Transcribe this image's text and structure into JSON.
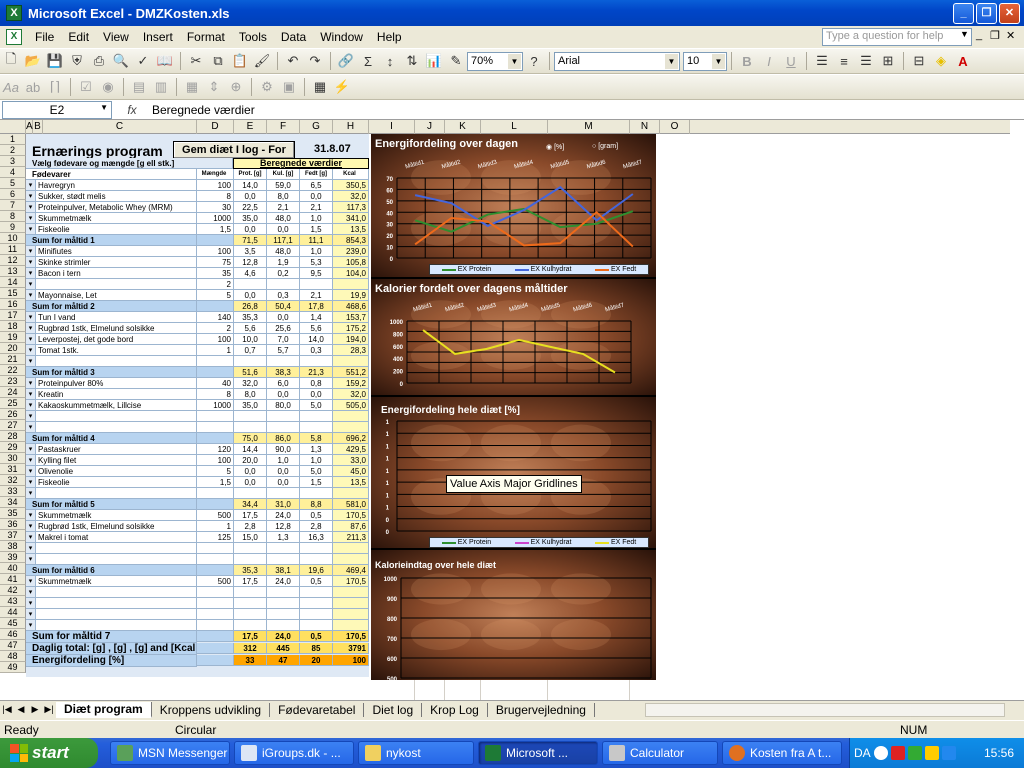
{
  "app": {
    "title": "Microsoft Excel - DMZKosten.xls"
  },
  "menu": [
    "File",
    "Edit",
    "View",
    "Insert",
    "Format",
    "Tools",
    "Data",
    "Window",
    "Help"
  ],
  "help_placeholder": "Type a question for help",
  "toolbar": {
    "zoom": "70%",
    "font": "Arial",
    "size": "10",
    "bold": "B",
    "italic": "I",
    "underline": "U"
  },
  "formula": {
    "cell": "E2",
    "fx": "fx",
    "value": "Beregnede værdier"
  },
  "columns": [
    "A",
    "B",
    "C",
    "D",
    "E",
    "F",
    "G",
    "H",
    "I",
    "J",
    "K",
    "L",
    "M",
    "N",
    "O"
  ],
  "rows": [
    "1",
    "2",
    "3",
    "4",
    "5",
    "6",
    "7",
    "8",
    "9",
    "10",
    "11",
    "12",
    "13",
    "14",
    "15",
    "16",
    "17",
    "18",
    "19",
    "20",
    "21",
    "22",
    "23",
    "24",
    "25",
    "26",
    "27",
    "28",
    "29",
    "30",
    "31",
    "32",
    "33",
    "34",
    "35",
    "36",
    "37",
    "38",
    "39",
    "40",
    "41",
    "42",
    "43",
    "44",
    "45",
    "46",
    "47",
    "48",
    "49"
  ],
  "program": {
    "title": "Ernærings program",
    "save_button": "Gem diæt I log - For",
    "date": "31.8.07",
    "choose": "Vælg fødevare og mængde [g ell stk.]",
    "calculated": "Beregnede værdier",
    "headers": [
      "Fødevarer",
      "Mængde",
      "Prot. [g]",
      "Kul. [g]",
      "Fedt [g]",
      "Kcal"
    ]
  },
  "table": [
    {
      "type": "item",
      "name": "Havregryn",
      "amt": "100",
      "p": "14,0",
      "k": "59,0",
      "f": "6,5",
      "kcal": "350,5"
    },
    {
      "type": "item",
      "name": "Sukker, stødt melis",
      "amt": "8",
      "p": "0,0",
      "k": "8,0",
      "f": "0,0",
      "kcal": "32,0"
    },
    {
      "type": "item",
      "name": "Proteinpulver, Metabolic Whey (MRM)",
      "amt": "30",
      "p": "22,5",
      "k": "2,1",
      "f": "2,1",
      "kcal": "117,3"
    },
    {
      "type": "item",
      "name": "Skummetmælk",
      "amt": "1000",
      "p": "35,0",
      "k": "48,0",
      "f": "1,0",
      "kcal": "341,0"
    },
    {
      "type": "item",
      "name": "Fiskeolie",
      "amt": "1,5",
      "p": "0,0",
      "k": "0,0",
      "f": "1,5",
      "kcal": "13,5"
    },
    {
      "type": "sum",
      "name": "Sum for måltid 1",
      "amt": "",
      "p": "71,5",
      "k": "117,1",
      "f": "11,1",
      "kcal": "854,3"
    },
    {
      "type": "item",
      "name": "Minifiutes",
      "amt": "100",
      "p": "3,5",
      "k": "48,0",
      "f": "1,0",
      "kcal": "239,0"
    },
    {
      "type": "item",
      "name": "Skinke strimler",
      "amt": "75",
      "p": "12,8",
      "k": "1,9",
      "f": "5,3",
      "kcal": "105,8"
    },
    {
      "type": "item",
      "name": "Bacon i tern",
      "amt": "35",
      "p": "4,6",
      "k": "0,2",
      "f": "9,5",
      "kcal": "104,0"
    },
    {
      "type": "item",
      "name": "",
      "amt": "2",
      "p": "",
      "k": "",
      "f": "",
      "kcal": ""
    },
    {
      "type": "item",
      "name": "Mayonnaise, Let",
      "amt": "5",
      "p": "0,0",
      "k": "0,3",
      "f": "2,1",
      "kcal": "19,9"
    },
    {
      "type": "sum",
      "name": "Sum for måltid 2",
      "amt": "",
      "p": "26,8",
      "k": "50,4",
      "f": "17,8",
      "kcal": "468,6"
    },
    {
      "type": "item",
      "name": "Tun I vand",
      "amt": "140",
      "p": "35,3",
      "k": "0,0",
      "f": "1,4",
      "kcal": "153,7"
    },
    {
      "type": "item",
      "name": "Rugbrød 1stk, Elmelund solsikke",
      "amt": "2",
      "p": "5,6",
      "k": "25,6",
      "f": "5,6",
      "kcal": "175,2"
    },
    {
      "type": "item",
      "name": "Leverpostej, det gode bord",
      "amt": "100",
      "p": "10,0",
      "k": "7,0",
      "f": "14,0",
      "kcal": "194,0"
    },
    {
      "type": "item",
      "name": "Tomat 1stk.",
      "amt": "1",
      "p": "0,7",
      "k": "5,7",
      "f": "0,3",
      "kcal": "28,3"
    },
    {
      "type": "item",
      "name": "",
      "amt": "",
      "p": "",
      "k": "",
      "f": "",
      "kcal": ""
    },
    {
      "type": "sum",
      "name": "Sum for måltid 3",
      "amt": "",
      "p": "51,6",
      "k": "38,3",
      "f": "21,3",
      "kcal": "551,2"
    },
    {
      "type": "item",
      "name": "Proteinpulver 80%",
      "amt": "40",
      "p": "32,0",
      "k": "6,0",
      "f": "0,8",
      "kcal": "159,2"
    },
    {
      "type": "item",
      "name": "Kreatin",
      "amt": "8",
      "p": "8,0",
      "k": "0,0",
      "f": "0,0",
      "kcal": "32,0"
    },
    {
      "type": "item",
      "name": "Kakaoskummetmælk, Lillcise",
      "amt": "1000",
      "p": "35,0",
      "k": "80,0",
      "f": "5,0",
      "kcal": "505,0"
    },
    {
      "type": "item",
      "name": "",
      "amt": "",
      "p": "",
      "k": "",
      "f": "",
      "kcal": ""
    },
    {
      "type": "item",
      "name": "",
      "amt": "",
      "p": "",
      "k": "",
      "f": "",
      "kcal": ""
    },
    {
      "type": "sum",
      "name": "Sum for måltid 4",
      "amt": "",
      "p": "75,0",
      "k": "86,0",
      "f": "5,8",
      "kcal": "696,2"
    },
    {
      "type": "item",
      "name": "Pastaskruer",
      "amt": "120",
      "p": "14,4",
      "k": "90,0",
      "f": "1,3",
      "kcal": "429,5"
    },
    {
      "type": "item",
      "name": "Kylling filet",
      "amt": "100",
      "p": "20,0",
      "k": "1,0",
      "f": "1,0",
      "kcal": "33,0"
    },
    {
      "type": "item",
      "name": "Olivenolie",
      "amt": "5",
      "p": "0,0",
      "k": "0,0",
      "f": "5,0",
      "kcal": "45,0"
    },
    {
      "type": "item",
      "name": "Fiskeolie",
      "amt": "1,5",
      "p": "0,0",
      "k": "0,0",
      "f": "1,5",
      "kcal": "13,5"
    },
    {
      "type": "item",
      "name": "",
      "amt": "",
      "p": "",
      "k": "",
      "f": "",
      "kcal": ""
    },
    {
      "type": "sum",
      "name": "Sum for måltid 5",
      "amt": "",
      "p": "34,4",
      "k": "31,0",
      "f": "8,8",
      "kcal": "581,0"
    },
    {
      "type": "item",
      "name": "Skummetmælk",
      "amt": "500",
      "p": "17,5",
      "k": "24,0",
      "f": "0,5",
      "kcal": "170,5"
    },
    {
      "type": "item",
      "name": "Rugbrød 1stk, Elmelund solsikke",
      "amt": "1",
      "p": "2,8",
      "k": "12,8",
      "f": "2,8",
      "kcal": "87,6"
    },
    {
      "type": "item",
      "name": "Makrel i tomat",
      "amt": "125",
      "p": "15,0",
      "k": "1,3",
      "f": "16,3",
      "kcal": "211,3"
    },
    {
      "type": "item",
      "name": "",
      "amt": "",
      "p": "",
      "k": "",
      "f": "",
      "kcal": ""
    },
    {
      "type": "item",
      "name": "",
      "amt": "",
      "p": "",
      "k": "",
      "f": "",
      "kcal": ""
    },
    {
      "type": "sum",
      "name": "Sum for måltid 6",
      "amt": "",
      "p": "35,3",
      "k": "38,1",
      "f": "19,6",
      "kcal": "469,4"
    },
    {
      "type": "item",
      "name": "Skummetmælk",
      "amt": "500",
      "p": "17,5",
      "k": "24,0",
      "f": "0,5",
      "kcal": "170,5"
    },
    {
      "type": "item",
      "name": "",
      "amt": "",
      "p": "",
      "k": "",
      "f": "",
      "kcal": ""
    },
    {
      "type": "item",
      "name": "",
      "amt": "",
      "p": "",
      "k": "",
      "f": "",
      "kcal": ""
    },
    {
      "type": "item",
      "name": "",
      "amt": "",
      "p": "",
      "k": "",
      "f": "",
      "kcal": ""
    },
    {
      "type": "item",
      "name": "",
      "amt": "",
      "p": "",
      "k": "",
      "f": "",
      "kcal": ""
    },
    {
      "type": "big",
      "name": "Sum for måltid 7",
      "amt": "",
      "p": "17,5",
      "k": "24,0",
      "f": "0,5",
      "kcal": "170,5"
    },
    {
      "type": "big",
      "name": "Daglig total: [g] , [g] , [g] and [Kcal.]",
      "amt": "",
      "p": "312",
      "k": "445",
      "f": "85",
      "kcal": "3791"
    },
    {
      "type": "orange",
      "name": "Energifordeling  [%]",
      "amt": "",
      "p": "33",
      "k": "47",
      "f": "20",
      "kcal": "100"
    }
  ],
  "charts": {
    "c1": {
      "title": "Energifordeling over dagen",
      "radio1": "[%]",
      "radio2": "[gram]",
      "categories": [
        "Måltid1",
        "Måltid2",
        "Måltid3",
        "Måltid4",
        "Måltid5",
        "Måltid6",
        "Måltid7"
      ],
      "yticks": [
        "70",
        "60",
        "50",
        "40",
        "30",
        "20",
        "10",
        "0"
      ],
      "legend": [
        "EX Protein",
        "EX Kulhydrat",
        "EX Fedt"
      ],
      "series_colors": [
        "#2f8f2f",
        "#4466dd",
        "#ee6a1a"
      ]
    },
    "c2": {
      "title": "Kalorier fordelt over dagens måltider",
      "categories": [
        "Måltid1",
        "Måltid2",
        "Måltid3",
        "Måltid4",
        "Måltid5",
        "Måltid6",
        "Måltid7"
      ],
      "yticks": [
        "1000",
        "800",
        "600",
        "400",
        "200",
        "0"
      ],
      "line_color": "#e8e020"
    },
    "c3": {
      "title": "Energifordeling hele diæt [%]",
      "yticks": [
        "1",
        "1",
        "1",
        "1",
        "1",
        "1",
        "1",
        "1",
        "0",
        "0"
      ],
      "legend": [
        "EX Protein",
        "EX Kulhydrat",
        "EX Fedt"
      ],
      "tooltip": "Value Axis Major Gridlines"
    },
    "c4": {
      "title": "Kalorieindtag over hele diæt",
      "yticks": [
        "1000",
        "900",
        "800",
        "700",
        "600",
        "500"
      ]
    }
  },
  "chart_data": [
    {
      "type": "line",
      "title": "Energifordeling over dagen",
      "categories": [
        "Måltid1",
        "Måltid2",
        "Måltid3",
        "Måltid4",
        "Måltid5",
        "Måltid6",
        "Måltid7"
      ],
      "ylim": [
        0,
        70
      ],
      "series": [
        {
          "name": "EX Protein",
          "values": [
            33,
            23,
            38,
            43,
            27,
            30,
            41
          ]
        },
        {
          "name": "EX Kulhydrat",
          "values": [
            55,
            48,
            28,
            42,
            62,
            33,
            56
          ]
        },
        {
          "name": "EX Fedt",
          "values": [
            12,
            35,
            32,
            11,
            13,
            40,
            10
          ]
        }
      ]
    },
    {
      "type": "line",
      "title": "Kalorier fordelt over dagens måltider",
      "categories": [
        "Måltid1",
        "Måltid2",
        "Måltid3",
        "Måltid4",
        "Måltid5",
        "Måltid6",
        "Måltid7"
      ],
      "ylim": [
        0,
        1000
      ],
      "series": [
        {
          "values": [
            854,
            469,
            551,
            696,
            581,
            469,
            170
          ]
        }
      ]
    }
  ],
  "sheet_tabs": [
    "Diæt program",
    "Kroppens udvikling",
    "Fødevaretabel",
    "Diet log",
    "Krop Log",
    "Brugervejledning"
  ],
  "status": {
    "left": "Ready",
    "mid": "Circular",
    "right": "NUM"
  },
  "taskbar": {
    "start": "start",
    "tasks": [
      "MSN Messenger",
      "iGroups.dk - ...",
      "nykost",
      "Microsoft ...",
      "Calculator",
      "Kosten fra A t..."
    ],
    "lang": "DA",
    "clock": "15:56"
  }
}
